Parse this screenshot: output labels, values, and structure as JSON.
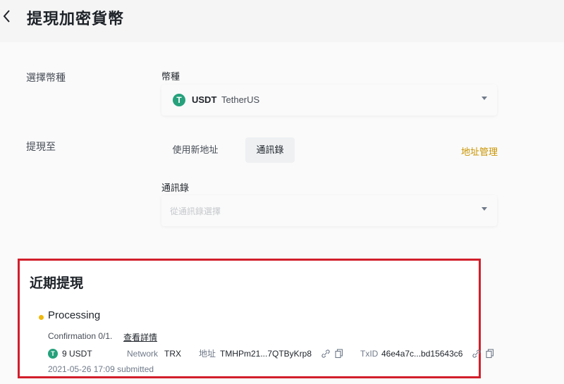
{
  "header": {
    "title": "提現加密貨幣",
    "back_icon": "chevron-left-icon"
  },
  "form": {
    "select_coin_label": "選擇幣種",
    "coin_field_label": "幣種",
    "coin": {
      "symbol": "USDT",
      "name": "TetherUS",
      "logo_glyph": "T",
      "logo_color": "#26a17b"
    },
    "withdraw_to_label": "提現至",
    "tabs": [
      {
        "label": "使用新地址",
        "active": false
      },
      {
        "label": "通訊錄",
        "active": true
      }
    ],
    "address_manage_label": "地址管理",
    "address_book_field_label": "通訊錄",
    "address_book_placeholder": "從通訊錄選擇"
  },
  "recent": {
    "title": "近期提現",
    "status": "Processing",
    "status_color": "#f0b90b",
    "confirmation_text": "Confirmation 0/1.",
    "details_link": "查看詳情",
    "amount": "9 USDT",
    "network_label": "Network",
    "network_value": "TRX",
    "address_label": "地址",
    "address_value": "TMHPm21...7QTByKrp8",
    "txid_label": "TxID",
    "txid_value": "46e4a7c...bd15643c6",
    "submitted_text": "2021-05-26 17:09 submitted"
  },
  "colors": {
    "accent": "#c99400",
    "highlight_border": "#d21f2b",
    "tether_green": "#26a17b"
  }
}
